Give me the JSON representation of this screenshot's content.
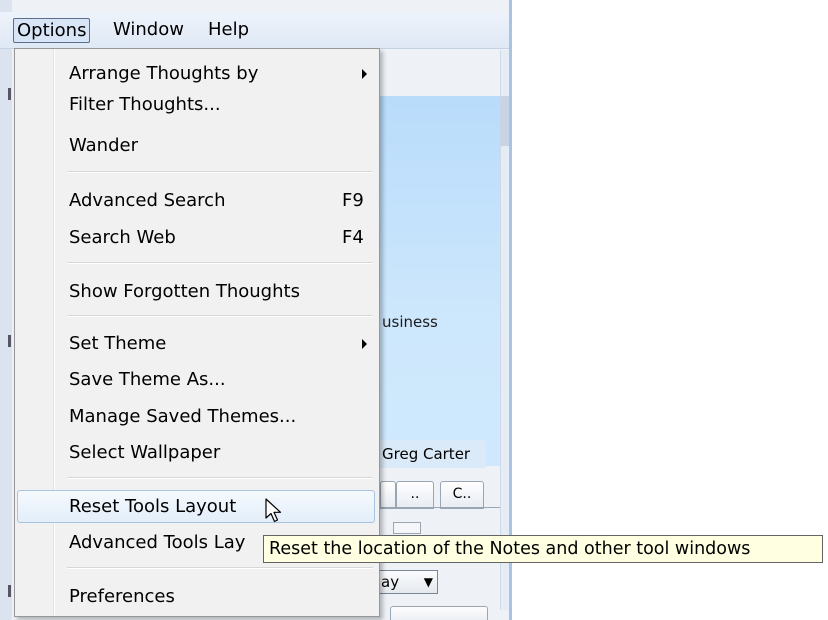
{
  "menubar": {
    "items": [
      {
        "label": "Options"
      },
      {
        "label": "Window"
      },
      {
        "label": "Help"
      }
    ]
  },
  "background": {
    "business_text": "usiness",
    "person_name": "Greg Carter",
    "tabs": [
      "",
      "..",
      "C.."
    ],
    "day_select": "ay"
  },
  "options_menu": {
    "items": [
      {
        "label": "Arrange Thoughts by",
        "shortcut": "",
        "submenu": true
      },
      {
        "label": "Filter Thoughts...",
        "shortcut": ""
      },
      {
        "label": "Wander",
        "shortcut": ""
      },
      {
        "label": "Advanced Search",
        "shortcut": "F9"
      },
      {
        "label": "Search Web",
        "shortcut": "F4"
      },
      {
        "label": "Show Forgotten Thoughts",
        "shortcut": ""
      },
      {
        "label": "Set Theme",
        "shortcut": "",
        "submenu": true
      },
      {
        "label": "Save Theme As...",
        "shortcut": ""
      },
      {
        "label": "Manage Saved Themes...",
        "shortcut": ""
      },
      {
        "label": "Select Wallpaper",
        "shortcut": ""
      },
      {
        "label": "Reset Tools Layout",
        "shortcut": "",
        "highlighted": true
      },
      {
        "label": "Advanced Tools Lay",
        "shortcut": ""
      },
      {
        "label": "Preferences",
        "shortcut": ""
      }
    ]
  },
  "tooltip": {
    "text": "Reset the location of the Notes and other tool windows"
  },
  "colors": {
    "menu_background": "#f1f1f1",
    "hover_border": "#a8c4e0",
    "tooltip_background": "#ffffe1",
    "pane_blue": "#b9dcfb"
  },
  "icons": {
    "cursor": "arrow-pointer-icon",
    "submenu": "submenu-arrow-icon",
    "dropdown": "chevron-down-icon"
  }
}
